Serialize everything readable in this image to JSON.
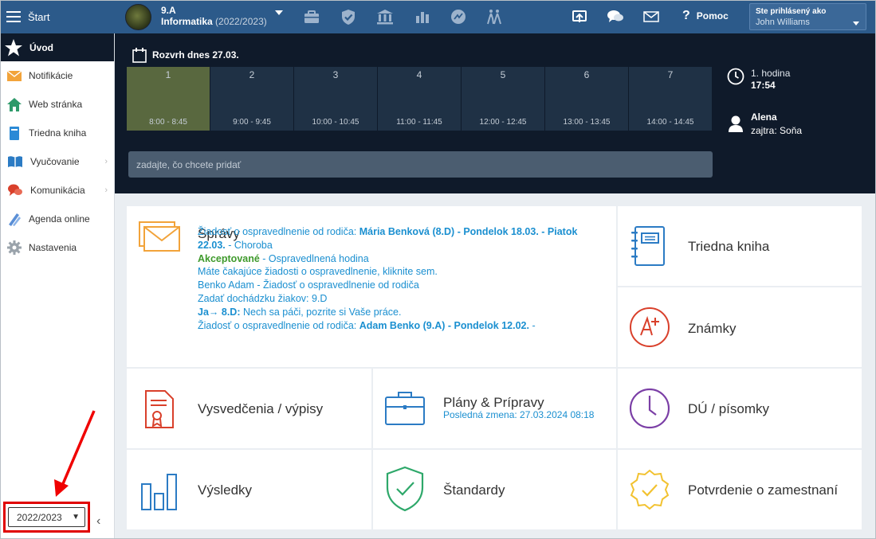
{
  "header": {
    "menu_label": "Štart",
    "class_name": "9.A",
    "subject": "Informatika",
    "school_year": "(2022/2023)",
    "help_label": "Pomoc",
    "signed_in_label": "Ste prihlásený ako",
    "user_name": "John Williams",
    "icons": [
      "briefcase-icon",
      "shield-check-icon",
      "bank-icon",
      "bar-chart-icon",
      "speedometer-icon",
      "walking-people-icon",
      "cast-icon",
      "chat-bubbles-icon",
      "envelope-icon",
      "question-icon"
    ]
  },
  "sidebar": {
    "items": [
      {
        "label": "Úvod",
        "icon": "star-icon"
      },
      {
        "label": "Notifikácie",
        "icon": "envelope-icon"
      },
      {
        "label": "Web stránka",
        "icon": "home-icon"
      },
      {
        "label": "Triedna kniha",
        "icon": "book-icon"
      },
      {
        "label": "Vyučovanie",
        "icon": "open-book-icon"
      },
      {
        "label": "Komunikácia",
        "icon": "chat-icon"
      },
      {
        "label": "Agenda online",
        "icon": "pencils-icon"
      },
      {
        "label": "Nastavenia",
        "icon": "gear-icon"
      }
    ],
    "year_select_value": "2022/2023"
  },
  "schedule": {
    "title": "Rozvrh dnes 27.03.",
    "hours": [
      {
        "num": "1",
        "time": "8:00 - 8:45"
      },
      {
        "num": "2",
        "time": "9:00 - 9:45"
      },
      {
        "num": "3",
        "time": "10:00 - 10:45"
      },
      {
        "num": "4",
        "time": "11:00 - 11:45"
      },
      {
        "num": "5",
        "time": "12:00 - 12:45"
      },
      {
        "num": "6",
        "time": "13:00 - 13:45"
      },
      {
        "num": "7",
        "time": "14:00 - 14:45"
      }
    ],
    "add_placeholder": "zadajte, čo chcete pridať",
    "current_hour_label": "1. hodina",
    "current_time": "17:54",
    "name_today": "Alena",
    "name_tomorrow": "zajtra: Soňa"
  },
  "tiles": {
    "messages": {
      "title": "Správy",
      "l1a": "Žiadosť o ospravedlnenie od rodiča: ",
      "l1b": "Mária Benková (8.D) - Pondelok 18.03. - Piatok",
      "l2a": "22.03.",
      "l2b": " - Choroba",
      "l3a": "Akceptované",
      "l3b": " - Ospravedlnená hodina",
      "l4": "Máte čakajúce žiadosti o ospravedlnenie, kliknite sem.",
      "l5": "Benko Adam - Žiadosť o ospravedlnenie od rodiča",
      "l6": "Zadať dochádzku žiakov: 9.D",
      "l7a": "Ja→ 8.D:",
      "l7b": " Nech sa páči, pozrite si Vaše práce.",
      "l8a": "Žiadosť o ospravedlnenie od rodiča: ",
      "l8b": "Adam Benko (9.A) - Pondelok 12.02.",
      "l8c": " -"
    },
    "class_book": "Triedna kniha",
    "grades": "Známky",
    "certificates": "Vysvedčenia / výpisy",
    "plans": "Plány & Prípravy",
    "plans_sub": "Posledná zmena: 27.03.2024 08:18",
    "homework": "DÚ / písomky",
    "results": "Výsledky",
    "standards": "Štandardy",
    "employment": "Potvrdenie o zamestnaní"
  }
}
